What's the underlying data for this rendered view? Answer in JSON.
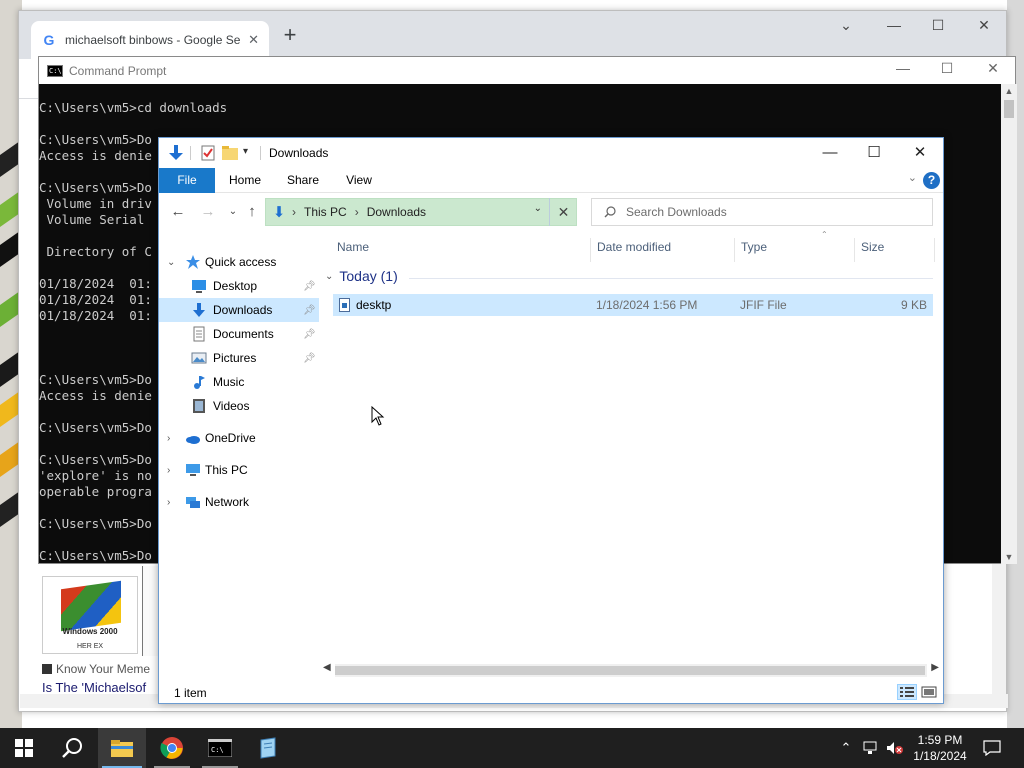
{
  "chrome": {
    "tab_title": "michaelsoft binbows - Google Se",
    "result_source": "Know Your Meme",
    "result_title": "Is The 'Michaelsof",
    "thumb_caption": "Windows 2000",
    "thumb_subcaption": "HER EX"
  },
  "cmd": {
    "title": "Command Prompt",
    "lines": [
      "C:\\Users\\vm5>cd downloads",
      "",
      "C:\\Users\\vm5>Do",
      "Access is denie",
      "",
      "C:\\Users\\vm5>Do",
      " Volume in driv",
      " Volume Serial",
      "",
      " Directory of C",
      "",
      "01/18/2024  01:",
      "01/18/2024  01:",
      "01/18/2024  01:",
      "",
      "",
      "",
      "C:\\Users\\vm5>Do",
      "Access is denie",
      "",
      "C:\\Users\\vm5>Do",
      "",
      "C:\\Users\\vm5>Do",
      "'explore' is no",
      "operable progra",
      "",
      "C:\\Users\\vm5>Do",
      "",
      "C:\\Users\\vm5>Do"
    ]
  },
  "explorer": {
    "title": "Downloads",
    "ribbon_tabs": [
      "File",
      "Home",
      "Share",
      "View"
    ],
    "address": {
      "crumbs": [
        "This PC",
        "Downloads"
      ]
    },
    "search_placeholder": "Search Downloads",
    "nav": [
      {
        "label": "Quick access",
        "icon": "star-icon",
        "pinned": false
      },
      {
        "label": "Desktop",
        "icon": "desktop-icon",
        "pinned": true
      },
      {
        "label": "Downloads",
        "icon": "download-icon",
        "pinned": true,
        "selected": true
      },
      {
        "label": "Documents",
        "icon": "documents-icon",
        "pinned": true
      },
      {
        "label": "Pictures",
        "icon": "pictures-icon",
        "pinned": true
      },
      {
        "label": "Music",
        "icon": "music-icon",
        "pinned": false
      },
      {
        "label": "Videos",
        "icon": "videos-icon",
        "pinned": false
      },
      {
        "label": "OneDrive",
        "icon": "cloud-icon",
        "pinned": false
      },
      {
        "label": "This PC",
        "icon": "computer-icon",
        "pinned": false
      },
      {
        "label": "Network",
        "icon": "network-icon",
        "pinned": false
      }
    ],
    "columns": [
      "Name",
      "Date modified",
      "Type",
      "Size"
    ],
    "group_label": "Today (1)",
    "files": [
      {
        "name": "desktp",
        "date": "1/18/2024 1:56 PM",
        "type": "JFIF File",
        "size": "9 KB"
      }
    ],
    "status": "1 item"
  },
  "taskbar": {
    "time": "1:59 PM",
    "date": "1/18/2024"
  },
  "colors": {
    "accent": "#1979ca",
    "selection": "#cce8ff",
    "address_bg": "#cbe8cf",
    "taskbar": "#1f1f1f"
  }
}
